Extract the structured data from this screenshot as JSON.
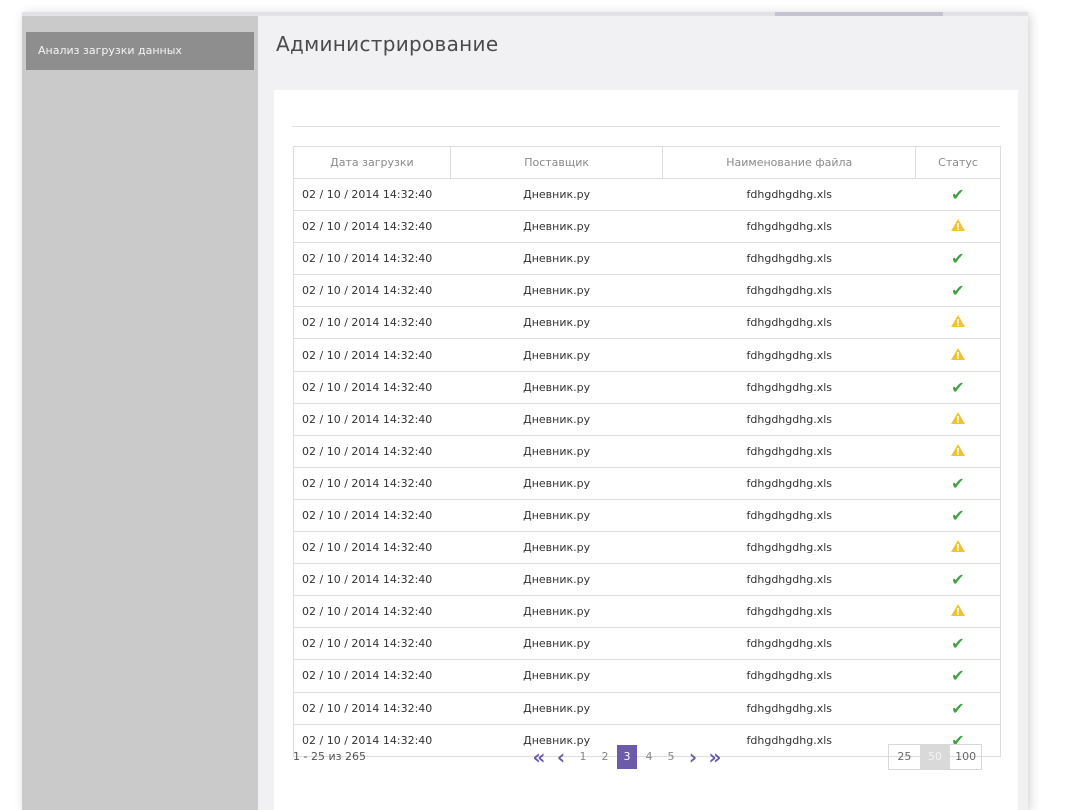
{
  "sidebar": {
    "items": [
      {
        "label": "Анализ загрузки данных"
      }
    ]
  },
  "main": {
    "title": "Администрирование"
  },
  "table": {
    "columns": [
      "Дата загрузки",
      "Поставщик",
      "Наименование файла",
      "Статус"
    ],
    "rows": [
      {
        "date": "02 / 10 / 2014   14:32:40",
        "supplier": "Дневник.ру",
        "file": "fdhgdhgdhg.xls",
        "status": "ok"
      },
      {
        "date": "02 / 10 / 2014   14:32:40",
        "supplier": "Дневник.ру",
        "file": "fdhgdhgdhg.xls",
        "status": "warning"
      },
      {
        "date": "02 / 10 / 2014   14:32:40",
        "supplier": "Дневник.ру",
        "file": "fdhgdhgdhg.xls",
        "status": "ok"
      },
      {
        "date": "02 / 10 / 2014   14:32:40",
        "supplier": "Дневник.ру",
        "file": "fdhgdhgdhg.xls",
        "status": "ok"
      },
      {
        "date": "02 / 10 / 2014   14:32:40",
        "supplier": "Дневник.ру",
        "file": "fdhgdhgdhg.xls",
        "status": "warning"
      },
      {
        "date": "02 / 10 / 2014   14:32:40",
        "supplier": "Дневник.ру",
        "file": "fdhgdhgdhg.xls",
        "status": "warning"
      },
      {
        "date": "02 / 10 / 2014   14:32:40",
        "supplier": "Дневник.ру",
        "file": "fdhgdhgdhg.xls",
        "status": "ok"
      },
      {
        "date": "02 / 10 / 2014   14:32:40",
        "supplier": "Дневник.ру",
        "file": "fdhgdhgdhg.xls",
        "status": "warning"
      },
      {
        "date": "02 / 10 / 2014   14:32:40",
        "supplier": "Дневник.ру",
        "file": "fdhgdhgdhg.xls",
        "status": "warning"
      },
      {
        "date": "02 / 10 / 2014   14:32:40",
        "supplier": "Дневник.ру",
        "file": "fdhgdhgdhg.xls",
        "status": "ok"
      },
      {
        "date": "02 / 10 / 2014   14:32:40",
        "supplier": "Дневник.ру",
        "file": "fdhgdhgdhg.xls",
        "status": "ok"
      },
      {
        "date": "02 / 10 / 2014   14:32:40",
        "supplier": "Дневник.ру",
        "file": "fdhgdhgdhg.xls",
        "status": "warning"
      },
      {
        "date": "02 / 10 / 2014   14:32:40",
        "supplier": "Дневник.ру",
        "file": "fdhgdhgdhg.xls",
        "status": "ok"
      },
      {
        "date": "02 / 10 / 2014   14:32:40",
        "supplier": "Дневник.ру",
        "file": "fdhgdhgdhg.xls",
        "status": "warning"
      },
      {
        "date": "02 / 10 / 2014   14:32:40",
        "supplier": "Дневник.ру",
        "file": "fdhgdhgdhg.xls",
        "status": "ok"
      },
      {
        "date": "02 / 10 / 2014   14:32:40",
        "supplier": "Дневник.ру",
        "file": "fdhgdhgdhg.xls",
        "status": "ok"
      },
      {
        "date": "02 / 10 / 2014   14:32:40",
        "supplier": "Дневник.ру",
        "file": "fdhgdhgdhg.xls",
        "status": "ok"
      },
      {
        "date": "02 / 10 / 2014   14:32:40",
        "supplier": "Дневник.ру",
        "file": "fdhgdhgdhg.xls",
        "status": "ok"
      }
    ]
  },
  "pagination": {
    "range_text": "1 - 25 из 265",
    "first_icon": "double-chevron-left-icon",
    "prev_icon": "chevron-left-icon",
    "next_icon": "chevron-right-icon",
    "last_icon": "double-chevron-right-icon",
    "pages": [
      "1",
      "2",
      "3",
      "4",
      "5"
    ],
    "current_page": "3",
    "page_sizes": [
      "25",
      "50",
      "100"
    ],
    "current_size": "50"
  },
  "colors": {
    "accent": "#6b5ba8",
    "ok": "#43a047",
    "warning": "#f2c230"
  }
}
